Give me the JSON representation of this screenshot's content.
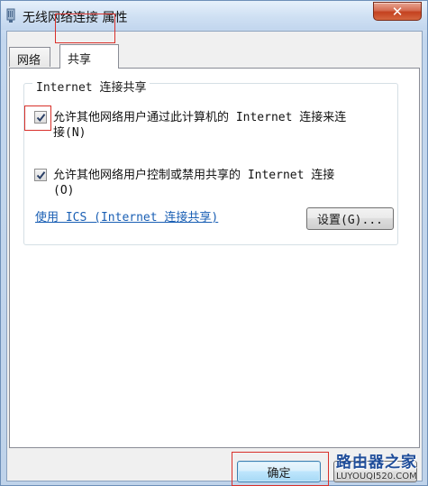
{
  "window": {
    "title": "无线网络连接 属性",
    "close_glyph": "✕"
  },
  "tabs": [
    {
      "label": "网络",
      "selected": false
    },
    {
      "label": "共享",
      "selected": true
    }
  ],
  "sharing": {
    "group_title": "Internet 连接共享",
    "option1": {
      "label_line1": "允许其他网络用户通过此计算机的 Internet 连接来连",
      "label_line2": "接(N)",
      "checked": true
    },
    "option2": {
      "label_line1": "允许其他网络用户控制或禁用共享的 Internet 连接",
      "label_line2": "(O)",
      "checked": true
    },
    "ics_link": "使用 ICS (Internet 连接共享)",
    "settings_button": "设置(G)..."
  },
  "footer": {
    "ok_button": "确定"
  },
  "watermark": {
    "title": "路由器之家",
    "url": "LUYOUQI520.COM"
  },
  "colors": {
    "highlight_box": "#d9302a",
    "link": "#1a5fb4"
  }
}
